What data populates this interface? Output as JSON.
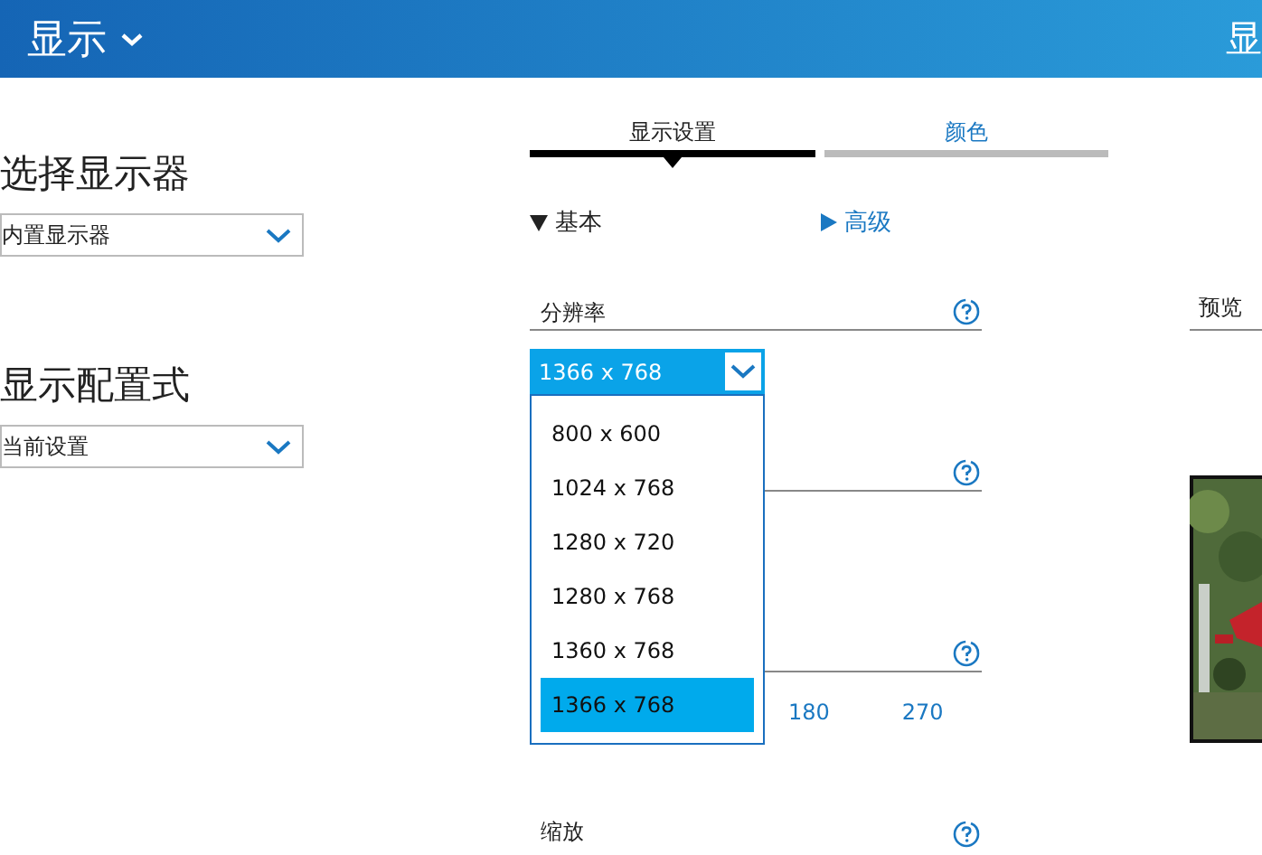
{
  "header": {
    "title": "显示",
    "right_title": "显"
  },
  "left": [
    {
      "label": "选择显示器",
      "value": "内置显示器"
    },
    {
      "label": "显示配置式",
      "value": "当前设置"
    }
  ],
  "tabs": [
    {
      "label": "显示设置",
      "selected": true
    },
    {
      "label": "颜色",
      "selected": false
    }
  ],
  "sections": [
    {
      "label": "基本",
      "expanded": true
    },
    {
      "label": "高级",
      "expanded": false
    }
  ],
  "settings": [
    {
      "kind": "resolution",
      "label": "分辨率",
      "value": "1366 x 768",
      "expanded": true,
      "options": [
        {
          "label": "800 x 600",
          "selected": false
        },
        {
          "label": "1024 x 768",
          "selected": false
        },
        {
          "label": "1280 x 720",
          "selected": false
        },
        {
          "label": "1280 x 768",
          "selected": false
        },
        {
          "label": "1360 x 768",
          "selected": false
        },
        {
          "label": "1366 x 768",
          "selected": true
        }
      ]
    },
    {
      "kind": "blank"
    },
    {
      "kind": "rotation",
      "options": [
        "180",
        "270"
      ]
    },
    {
      "kind": "scale",
      "label": "缩放"
    }
  ],
  "preview": {
    "label": "预览",
    "kind": "picture"
  }
}
